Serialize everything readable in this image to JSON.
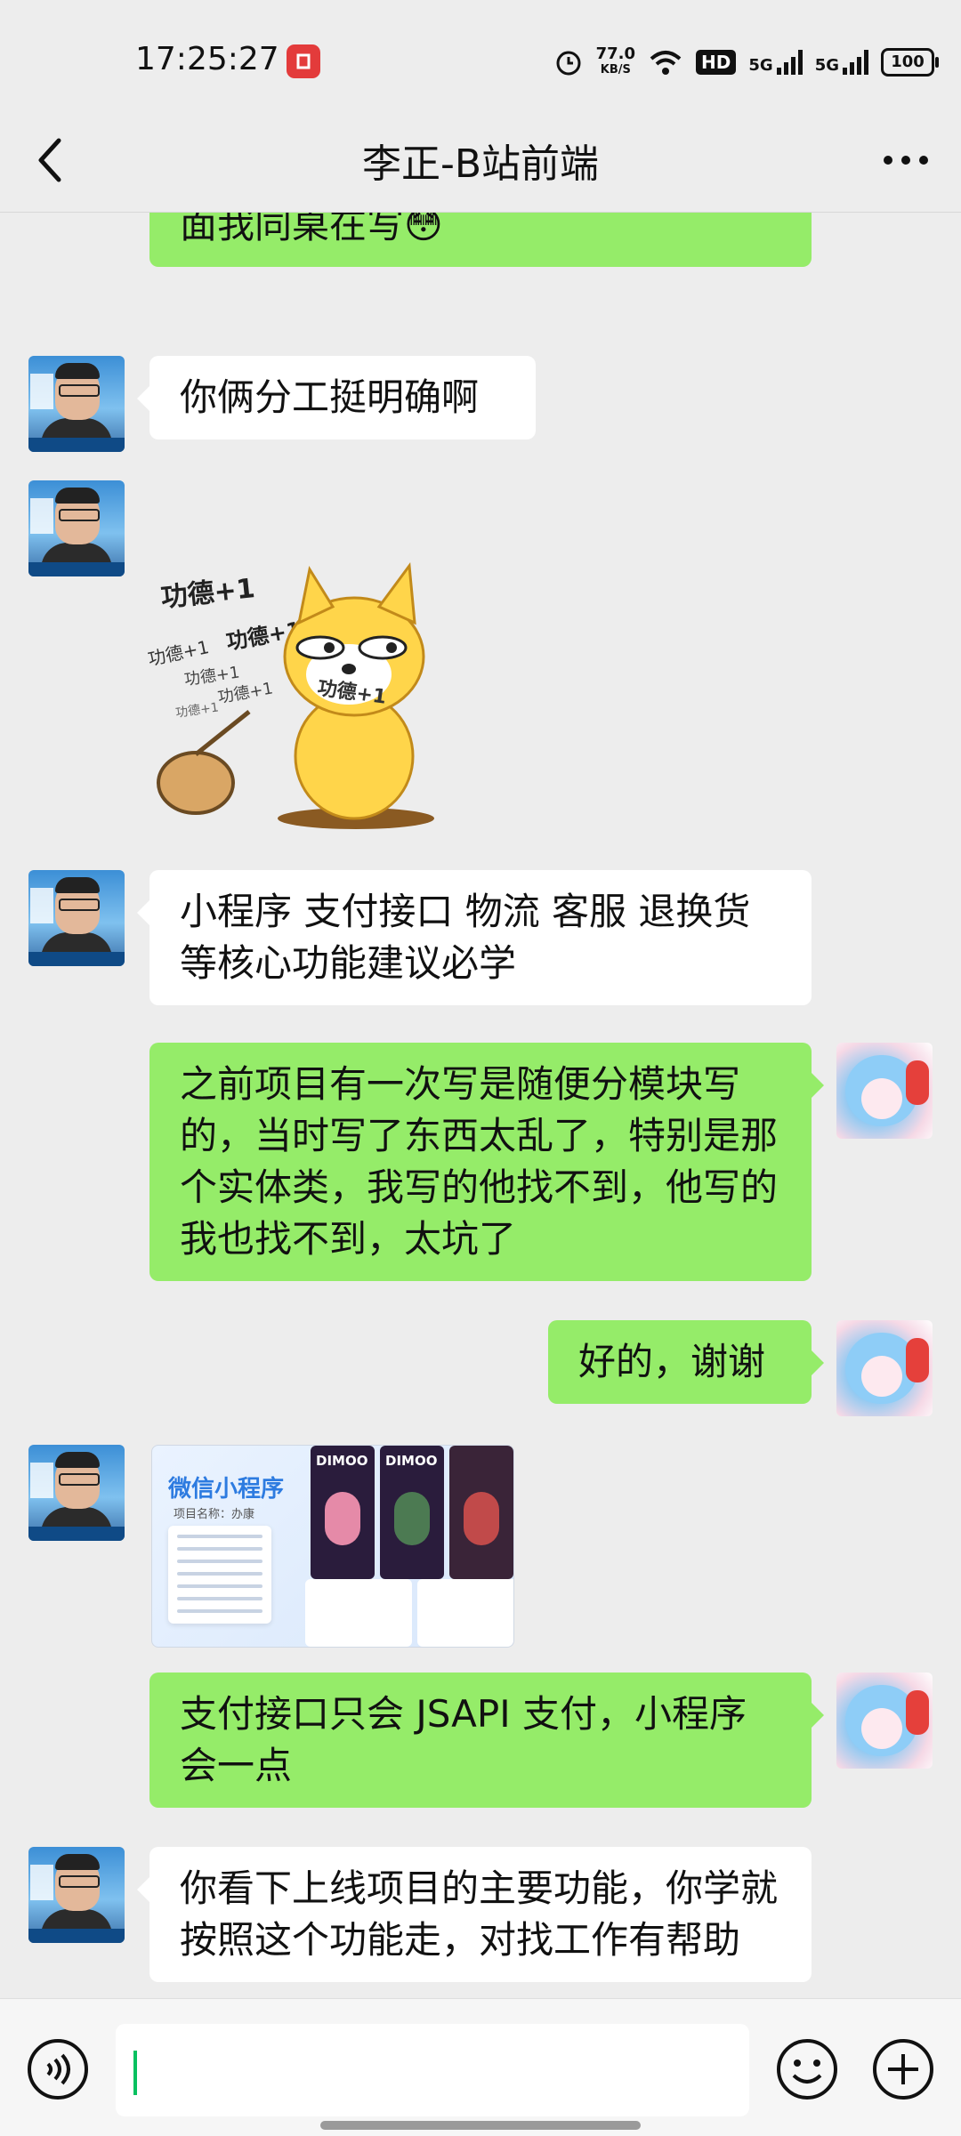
{
  "status_bar": {
    "time": "17:25:27",
    "speed_value": "77.0",
    "speed_unit": "KB/S",
    "hd_label": "HD",
    "net1": "5G",
    "net2": "5G",
    "battery": "100"
  },
  "header": {
    "title": "李正-B站前端",
    "back_icon": "chevron-left-icon",
    "more_icon": "more-dots-icon"
  },
  "messages": [
    {
      "side": "out",
      "text": "卖项目，主要是写后端接口，前端页面我同桌在写😳"
    },
    {
      "side": "in",
      "text": "你俩分工挺明确啊"
    },
    {
      "side": "in",
      "type": "sticker",
      "caption": [
        "功德+1",
        "功德+1",
        "功德+1",
        "功德+1",
        "功德+1",
        "功德+1"
      ]
    },
    {
      "side": "in",
      "text": "小程序  支付接口  物流  客服  退换货 等核心功能建议必学"
    },
    {
      "side": "out",
      "text": "之前项目有一次写是随便分模块写的，当时写了东西太乱了，特别是那个实体类，我写的他找不到，他写的我也找不到，太坑了"
    },
    {
      "side": "out",
      "text": "好的，谢谢"
    },
    {
      "side": "in",
      "type": "image",
      "image_title": "微信小程序",
      "image_subtitle": "项目名称：办康",
      "phone_labels": [
        "DIMOO",
        "DIMOO"
      ]
    },
    {
      "side": "out",
      "text": "支付接口只会 JSAPI 支付，小程序会一点"
    },
    {
      "side": "in",
      "text": "你看下上线项目的主要功能，你学就按照这个功能走，对找工作有帮助"
    }
  ],
  "input_bar": {
    "voice_icon": "voice-icon",
    "emoji_icon": "emoji-icon",
    "plus_icon": "plus-icon"
  }
}
